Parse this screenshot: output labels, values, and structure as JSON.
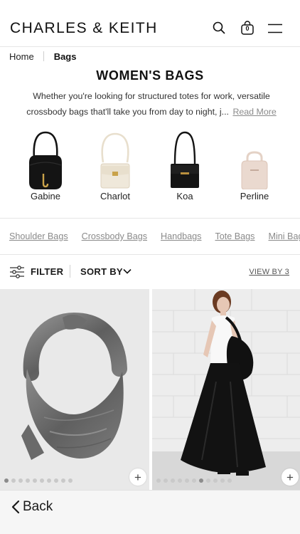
{
  "header": {
    "brand": "CHARLES & KEITH",
    "cart_count": "0",
    "icons": [
      "search-icon",
      "bag-icon",
      "menu-icon"
    ]
  },
  "breadcrumb": {
    "home": "Home",
    "current": "Bags"
  },
  "page": {
    "title": "WOMEN'S BAGS",
    "description": "Whether you're looking for structured totes for work, versatile crossbody bags that'll take you from day to night, j...",
    "read_more": "Read More"
  },
  "shapes": [
    {
      "label": "Gabine",
      "color": "#141414"
    },
    {
      "label": "Charlot",
      "color": "#efe8da"
    },
    {
      "label": "Koa",
      "color": "#141414"
    },
    {
      "label": "Perline",
      "color": "#ead9cf"
    }
  ],
  "categories": [
    "Shoulder Bags",
    "Crossbody Bags",
    "Handbags",
    "Tote Bags",
    "Mini Bags"
  ],
  "toolbar": {
    "filter": "FILTER",
    "sort": "SORT BY",
    "view_by": "VIEW BY 3"
  },
  "products": [
    {
      "image": "grey-denim-hobo-bag",
      "images_count": 10,
      "active_image": 1,
      "add_label": "+"
    },
    {
      "image": "model-with-black-hobo-bag",
      "images_count": 11,
      "active_image": 7,
      "add_label": "+"
    }
  ],
  "bottom": {
    "back": "Back"
  }
}
